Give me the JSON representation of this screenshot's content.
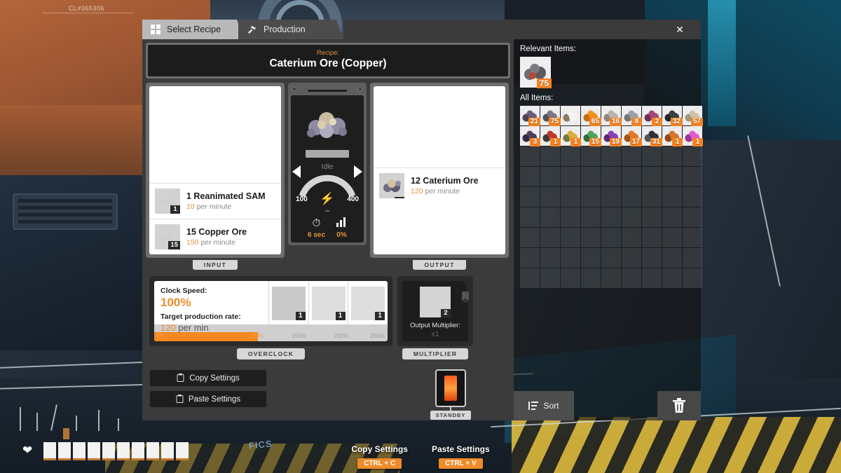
{
  "hud": {
    "cl_code": "CL#365306",
    "fics_label": "FICS",
    "hints": [
      {
        "label": "Copy Settings",
        "key": "CTRL + C"
      },
      {
        "label": "Paste Settings",
        "key": "CTRL + V"
      }
    ],
    "hotbar_slots": 10
  },
  "window": {
    "tabs": [
      {
        "label": "Select Recipe",
        "icon": "grid-icon",
        "active": true
      },
      {
        "label": "Production",
        "icon": "hammer-icon",
        "active": false
      }
    ],
    "close_label": "✕"
  },
  "recipe": {
    "label": "Recipe:",
    "name": "Caterium Ore (Copper)"
  },
  "input": {
    "tab_label": "INPUT",
    "items": [
      {
        "name": "1 Reanimated SAM",
        "rate_value": "10",
        "rate_unit": " per minute",
        "badge": "1"
      },
      {
        "name": "15 Copper Ore",
        "rate_value": "150",
        "rate_unit": " per minute",
        "badge": "15"
      }
    ]
  },
  "output": {
    "tab_label": "OUTPUT",
    "items": [
      {
        "name": "12 Caterium Ore",
        "rate_value": "120",
        "rate_unit": " per minute",
        "badge": ""
      }
    ]
  },
  "machine": {
    "status": "Idle",
    "gauge_min": "100",
    "gauge_max": "400",
    "power_icon": "lightning-bolt-icon",
    "stats": [
      {
        "icon": "stopwatch-icon",
        "value": "6 sec"
      },
      {
        "icon": "bar-chart-icon",
        "value": "0%"
      }
    ],
    "prev_label": "◀",
    "next_label": "▶"
  },
  "overclock": {
    "clock_speed_label": "Clock Speed:",
    "clock_speed_value": "100%",
    "target_rate_label": "Target production rate:",
    "target_rate_value": "120",
    "target_rate_unit": " per min",
    "slider_ticks": [
      "0%",
      "100%",
      "150%",
      "200%",
      "250%"
    ],
    "fill_percent": 44.5,
    "shard_slots": [
      {
        "badge": "1"
      },
      {
        "badge": "1"
      },
      {
        "badge": "1"
      }
    ],
    "button_label": "OVERCLOCK"
  },
  "multiplier": {
    "title": "Output Multiplier:",
    "value": "x1",
    "badge": "2",
    "button_label": "MULTIPLIER"
  },
  "actions": {
    "copy_settings": "Copy Settings",
    "paste_settings": "Paste Settings",
    "standby_label": "STANDBY"
  },
  "inventory": {
    "relevant_title": "Relevant Items:",
    "all_title": "All Items:",
    "relevant_items": [
      {
        "name": "caterium-ore",
        "count": "75",
        "color": "#6e6a72",
        "color2": "#b4493a"
      }
    ],
    "all_items": [
      {
        "name": "ore-purple",
        "count": "21",
        "color": "#6a5d7a",
        "color2": "#4a4255"
      },
      {
        "name": "ore-grey",
        "count": "75",
        "color": "#7a7a80",
        "color2": "#53535a"
      },
      {
        "name": "tool-wrench",
        "count": "",
        "color": "#f4f4f4",
        "color2": "#8a7a5e"
      },
      {
        "name": "crate-orange",
        "count": "65",
        "color": "#f0921f",
        "color2": "#c06f10"
      },
      {
        "name": "rock-grey",
        "count": "16",
        "color": "#b8b5ae",
        "color2": "#8a8780"
      },
      {
        "name": "metal-grey",
        "count": "8",
        "color": "#9aa0a6",
        "color2": "#6e757b"
      },
      {
        "name": "ore-magenta",
        "count": "2",
        "color": "#a04a7a",
        "color2": "#6e3054"
      },
      {
        "name": "ore-black",
        "count": "32",
        "color": "#3a3f46",
        "color2": "#23272c"
      },
      {
        "name": "stone-tan",
        "count": "57",
        "color": "#cfc3ad",
        "color2": "#a2977f"
      },
      {
        "name": "ore-darkpurple",
        "count": "3",
        "color": "#4e3f5c",
        "color2": "#332940"
      },
      {
        "name": "tool-red",
        "count": "1",
        "color": "#c03a2c",
        "color2": "#3a3a3a"
      },
      {
        "name": "plant-yellow",
        "count": "1",
        "color": "#d3b03a",
        "color2": "#6e7a3a"
      },
      {
        "name": "crystal-green",
        "count": "15",
        "color": "#4fa35c",
        "color2": "#2f6e39"
      },
      {
        "name": "crystal-purple",
        "count": "19",
        "color": "#8b3fb8",
        "color2": "#5a2578"
      },
      {
        "name": "part-orange",
        "count": "17",
        "color": "#e07a2a",
        "color2": "#a05418"
      },
      {
        "name": "gear-black",
        "count": "31",
        "color": "#2e3238",
        "color2": "#50565e"
      },
      {
        "name": "part-copper",
        "count": "1",
        "color": "#d5762e",
        "color2": "#8c4a18"
      },
      {
        "name": "crystal-pink",
        "count": "1",
        "color": "#e05ad0",
        "color2": "#a02f96"
      }
    ],
    "empty_rows": 7,
    "empty_cols": 9,
    "sort_label": "Sort",
    "trash_label": "trash-icon"
  }
}
